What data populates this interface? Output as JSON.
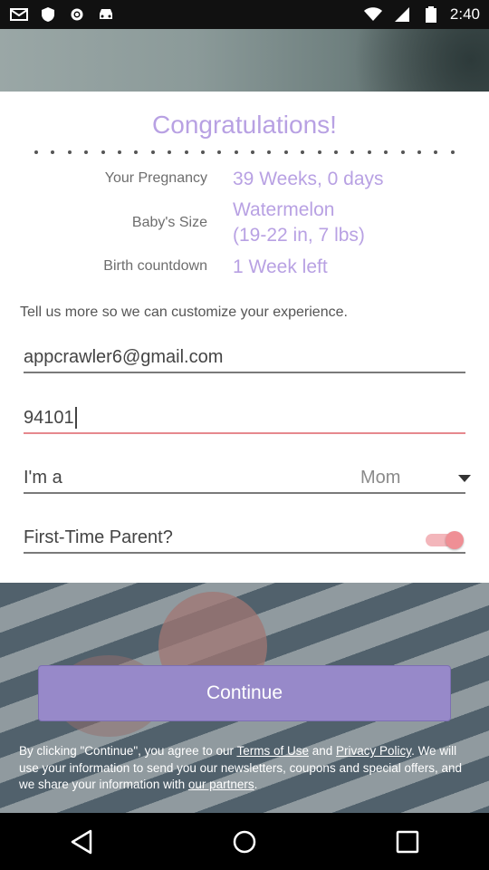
{
  "status_bar": {
    "time": "2:40",
    "icons_left": [
      "email-icon",
      "shield-icon",
      "settings-icon",
      "car-icon"
    ],
    "icons_right": [
      "wifi-icon",
      "signal-icon",
      "battery-icon"
    ]
  },
  "card": {
    "title": "Congratulations!",
    "rows": [
      {
        "label": "Your Pregnancy",
        "value": "39 Weeks, 0 days"
      },
      {
        "label": "Baby's Size",
        "value_line1": "Watermelon",
        "value_line2": "(19-22 in, 7 lbs)"
      },
      {
        "label": "Birth countdown",
        "value": "1 Week left"
      }
    ],
    "tell_us": "Tell us more so we can customize your experience."
  },
  "form": {
    "email_value": "appcrawler6@gmail.com",
    "zip_value": "94101",
    "role_label": "I'm a",
    "role_value": "Mom",
    "first_time_label": "First-Time Parent?",
    "first_time_on": true
  },
  "footer": {
    "continue_label": "Continue",
    "legal_text_1": "By clicking \"Continue\", you agree to our ",
    "terms_link": "Terms of Use",
    "legal_and": " and ",
    "privacy_link": "Privacy Policy",
    "legal_text_2": ". We will use your information to send you our newsletters, coupons and special offers, and we share your information with ",
    "partners_link": "our partners",
    "legal_end": "."
  },
  "colors": {
    "accent_purple": "#b8a1e3",
    "button_purple": "#9789c9",
    "toggle_pink": "#ef8f95"
  },
  "nav": [
    "back-icon",
    "home-icon",
    "recents-icon"
  ]
}
